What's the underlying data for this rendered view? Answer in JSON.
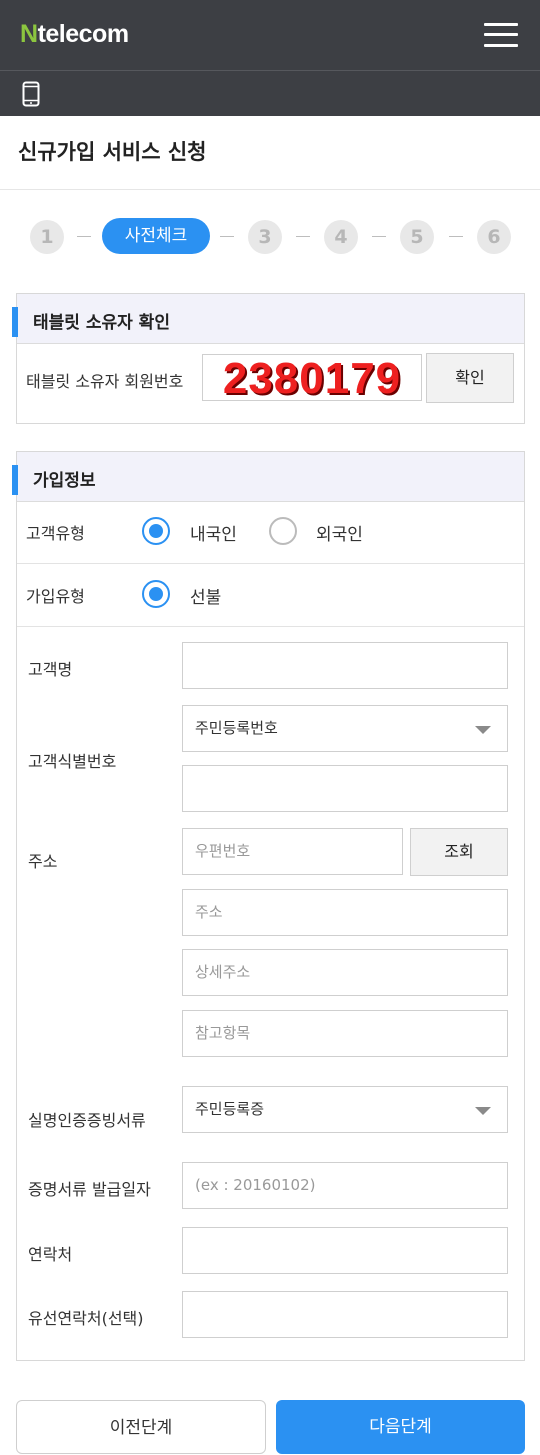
{
  "header": {
    "logo_n": "N",
    "logo_rest": "telecom",
    "menu_icon": "hamburger-icon",
    "device_icon": "mobile-phone-icon"
  },
  "page_title": "신규가입 서비스 신청",
  "steps": [
    "1",
    "사전체크",
    "3",
    "4",
    "5",
    "6"
  ],
  "owner_section": {
    "title": "태블릿 소유자 확인",
    "label": "태블릿 소유자 회원번호",
    "member_number": "2380179",
    "confirm_label": "확인"
  },
  "join_section": {
    "title": "가입정보",
    "customer_type_label": "고객유형",
    "customer_type_options": [
      "내국인",
      "외국인"
    ],
    "customer_type_selected": "내국인",
    "join_type_label": "가입유형",
    "join_type_options": [
      "선불"
    ],
    "join_type_selected": "선불",
    "name_label": "고객명",
    "name_value": "",
    "id_label": "고객식별번호",
    "id_type_selected": "주민등록번호",
    "id_value": "",
    "address_label": "주소",
    "postal_placeholder": "우편번호",
    "lookup_label": "조회",
    "address_placeholder": "주소",
    "detail_address_placeholder": "상세주소",
    "reference_placeholder": "참고항목",
    "doc_label": "실명인증증빙서류",
    "doc_selected": "주민등록증",
    "issue_date_label": "증명서류 발급일자",
    "issue_date_placeholder": "(ex : 20160102)",
    "contact_label": "연락처",
    "landline_label": "유선연락처(선택)"
  },
  "footer": {
    "prev_label": "이전단계",
    "next_label": "다음단계"
  },
  "colors": {
    "accent": "#2b91f2",
    "header_bg": "#3d3f44",
    "logo_green": "#8cc63f",
    "member_number_red": "#ee2020"
  }
}
